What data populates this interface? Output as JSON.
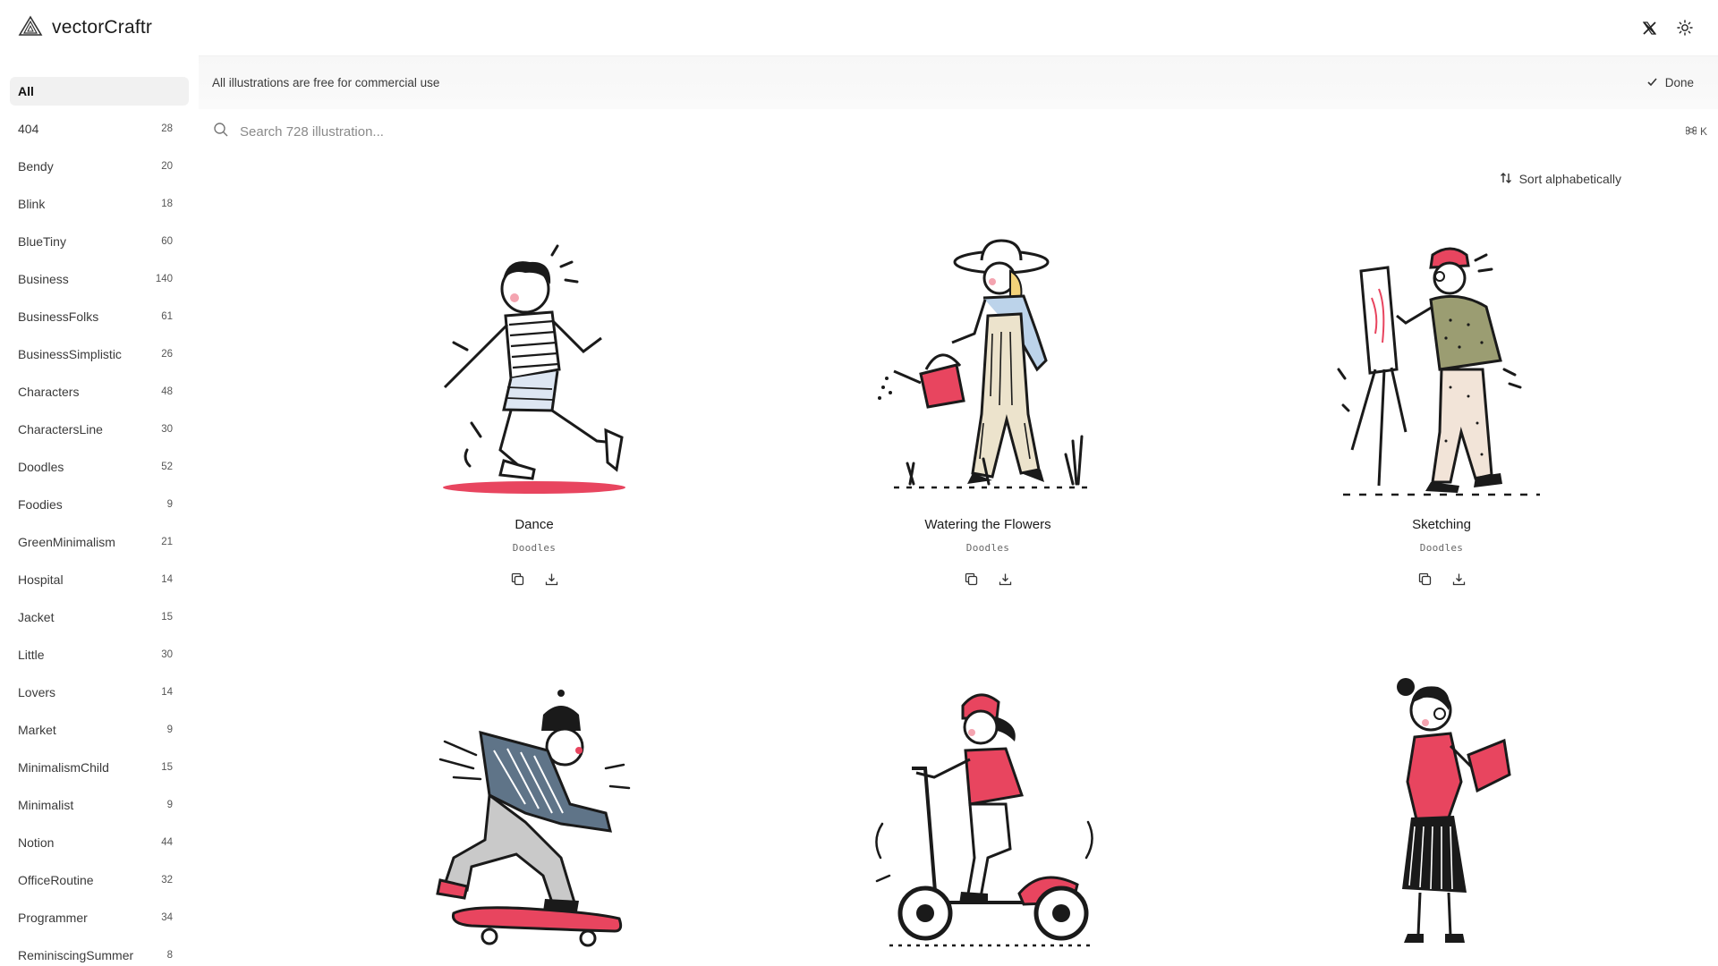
{
  "app": {
    "name": "vectorCraftr"
  },
  "sidebar": {
    "items": [
      {
        "label": "All",
        "count": "",
        "active": true
      },
      {
        "label": "404",
        "count": "28"
      },
      {
        "label": "Bendy",
        "count": "20"
      },
      {
        "label": "Blink",
        "count": "18"
      },
      {
        "label": "BlueTiny",
        "count": "60"
      },
      {
        "label": "Business",
        "count": "140"
      },
      {
        "label": "BusinessFolks",
        "count": "61"
      },
      {
        "label": "BusinessSimplistic",
        "count": "26"
      },
      {
        "label": "Characters",
        "count": "48"
      },
      {
        "label": "CharactersLine",
        "count": "30"
      },
      {
        "label": "Doodles",
        "count": "52"
      },
      {
        "label": "Foodies",
        "count": "9"
      },
      {
        "label": "GreenMinimalism",
        "count": "21"
      },
      {
        "label": "Hospital",
        "count": "14"
      },
      {
        "label": "Jacket",
        "count": "15"
      },
      {
        "label": "Little",
        "count": "30"
      },
      {
        "label": "Lovers",
        "count": "14"
      },
      {
        "label": "Market",
        "count": "9"
      },
      {
        "label": "MinimalismChild",
        "count": "15"
      },
      {
        "label": "Minimalist",
        "count": "9"
      },
      {
        "label": "Notion",
        "count": "44"
      },
      {
        "label": "OfficeRoutine",
        "count": "32"
      },
      {
        "label": "Programmer",
        "count": "34"
      },
      {
        "label": "ReminiscingSummer",
        "count": "8"
      }
    ]
  },
  "notice": {
    "text": "All illustrations are free for commercial use",
    "done_label": "Done"
  },
  "search": {
    "placeholder": "Search 728 illustration...",
    "shortcut": "K"
  },
  "sort": {
    "label": "Sort alphabetically"
  },
  "cards": [
    {
      "title": "Dance",
      "category": "Doodles"
    },
    {
      "title": "Watering the Flowers",
      "category": "Doodles"
    },
    {
      "title": "Sketching",
      "category": "Doodles"
    },
    {
      "title": "",
      "category": ""
    },
    {
      "title": "",
      "category": ""
    },
    {
      "title": "",
      "category": ""
    }
  ],
  "colors": {
    "accent": "#e8455f",
    "ink": "#1a1a1a",
    "muted": "#8a8a8a"
  }
}
